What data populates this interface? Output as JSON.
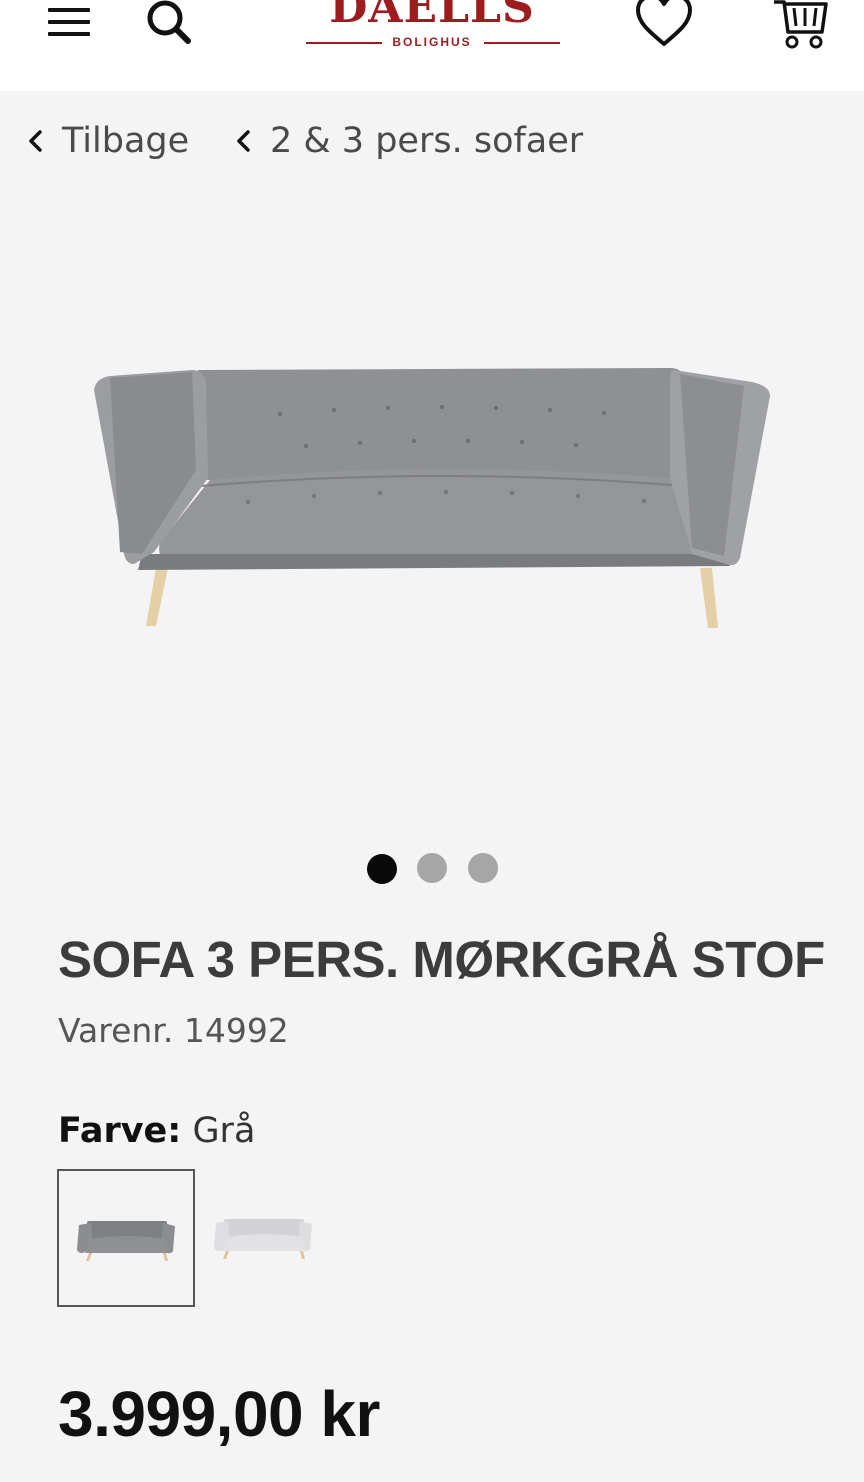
{
  "header": {
    "logo_word": "DAELLS",
    "logo_sub": "BOLIGHUS",
    "brand_color": "#9e1b1e",
    "icons": [
      "menu-icon",
      "search-icon",
      "heart-icon",
      "cart-icon"
    ]
  },
  "breadcrumb": {
    "back_label": "Tilbage",
    "category_label": "2 & 3 pers. sofaer",
    "chevron_icon": "chevron-left-icon"
  },
  "gallery": {
    "total_images": 3,
    "active_index": 1,
    "active_dot_color": "#0a0a0a",
    "inactive_dot_color": "#a6a6a6"
  },
  "product": {
    "title": "SOFA 3 PERS. MØRKGRÅ STOF",
    "sku_label": "Varenr.",
    "sku_value": "14992",
    "color_label": "Farve:",
    "color_value": "Grå",
    "swatches": [
      {
        "name": "mørkgrå",
        "fabric_color": "#8c8d91",
        "selected": true
      },
      {
        "name": "lysegrå",
        "fabric_color": "#dcdcdc",
        "selected": false
      }
    ],
    "price": "3.999,00 kr"
  }
}
